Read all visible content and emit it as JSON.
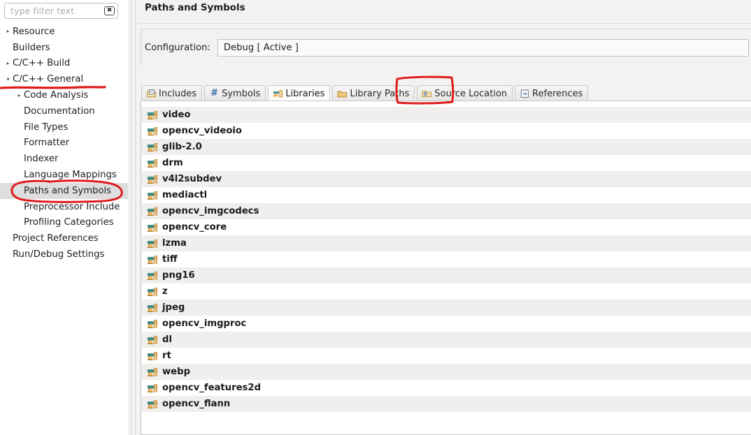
{
  "filter": {
    "placeholder": "type filter text",
    "value": "",
    "clear_icon": "clear-circle-icon"
  },
  "tree": {
    "items": [
      {
        "label": "Resource",
        "level": 0,
        "arrow": "collapsed",
        "selected": false
      },
      {
        "label": "Builders",
        "level": 0,
        "arrow": "none",
        "selected": false
      },
      {
        "label": "C/C++ Build",
        "level": 0,
        "arrow": "collapsed",
        "selected": false
      },
      {
        "label": "C/C++ General",
        "level": 0,
        "arrow": "expanded",
        "selected": false
      },
      {
        "label": "Code Analysis",
        "level": 1,
        "arrow": "collapsed",
        "selected": false
      },
      {
        "label": "Documentation",
        "level": 1,
        "arrow": "none",
        "selected": false
      },
      {
        "label": "File Types",
        "level": 1,
        "arrow": "none",
        "selected": false
      },
      {
        "label": "Formatter",
        "level": 1,
        "arrow": "none",
        "selected": false
      },
      {
        "label": "Indexer",
        "level": 1,
        "arrow": "none",
        "selected": false
      },
      {
        "label": "Language Mappings",
        "level": 1,
        "arrow": "none",
        "selected": false
      },
      {
        "label": "Paths and Symbols",
        "level": 1,
        "arrow": "none",
        "selected": true
      },
      {
        "label": "Preprocessor Include",
        "level": 1,
        "arrow": "none",
        "selected": false
      },
      {
        "label": "Profiling Categories",
        "level": 1,
        "arrow": "none",
        "selected": false
      },
      {
        "label": "Project References",
        "level": 0,
        "arrow": "none",
        "selected": false
      },
      {
        "label": "Run/Debug Settings",
        "level": 0,
        "arrow": "none",
        "selected": false
      }
    ]
  },
  "page": {
    "title": "Paths and Symbols"
  },
  "configuration": {
    "label": "Configuration:",
    "value": "Debug  [ Active ]"
  },
  "tabs": [
    {
      "label": "Includes",
      "icon": "includes-icon",
      "active": false
    },
    {
      "label": "Symbols",
      "icon": "hash-icon",
      "active": false
    },
    {
      "label": "Libraries",
      "icon": "libraries-icon",
      "active": true
    },
    {
      "label": "Library Paths",
      "icon": "folder-icon",
      "active": false
    },
    {
      "label": "Source Location",
      "icon": "source-folder-icon",
      "active": false
    },
    {
      "label": "References",
      "icon": "references-icon",
      "active": false
    }
  ],
  "libraries": [
    "video",
    "opencv_videoio",
    "glib-2.0",
    "drm",
    "v4l2subdev",
    "mediactl",
    "opencv_imgcodecs",
    "opencv_core",
    "lzma",
    "tiff",
    "png16",
    "z",
    "jpeg",
    "opencv_imgproc",
    "dl",
    "rt",
    "webp",
    "opencv_features2d",
    "opencv_flann"
  ],
  "annotations": {
    "color": "#e01b1b",
    "items": [
      {
        "name": "underline-cpp-general",
        "shape": "underline"
      },
      {
        "name": "oval-paths-and-symbols",
        "shape": "oval"
      },
      {
        "name": "rect-libraries-tab",
        "shape": "rectangle"
      }
    ]
  }
}
